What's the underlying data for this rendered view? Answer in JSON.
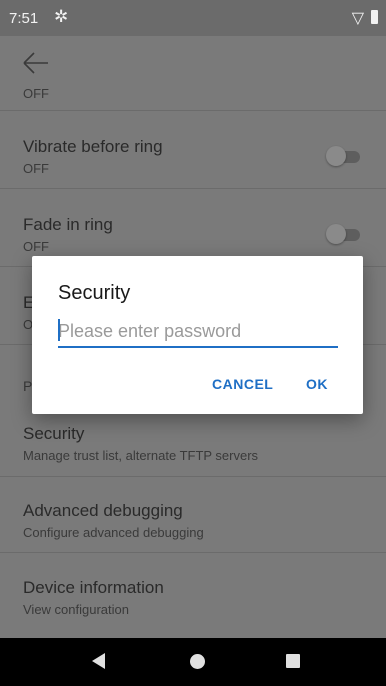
{
  "status_bar": {
    "time": "7:51"
  },
  "settings": [
    {
      "title": "Vibrate before ring",
      "subtitle": "OFF"
    },
    {
      "title": "Fade in ring",
      "subtitle": "OFF"
    },
    {
      "title": "E",
      "subtitle": "O"
    },
    {
      "title": "P",
      "subtitle": ""
    },
    {
      "title": "Security",
      "subtitle": "Manage trust list, alternate TFTP servers"
    },
    {
      "title": "Advanced debugging",
      "subtitle": "Configure advanced debugging"
    },
    {
      "title": "Device information",
      "subtitle": "View configuration"
    }
  ],
  "partial_top_subtitle": "OFF",
  "dialog": {
    "title": "Security",
    "input_placeholder": "Please enter password",
    "input_value": "",
    "cancel_label": "CANCEL",
    "ok_label": "OK"
  },
  "colors": {
    "accent": "#1f6fc5",
    "scrim": "#7a7a7a"
  }
}
